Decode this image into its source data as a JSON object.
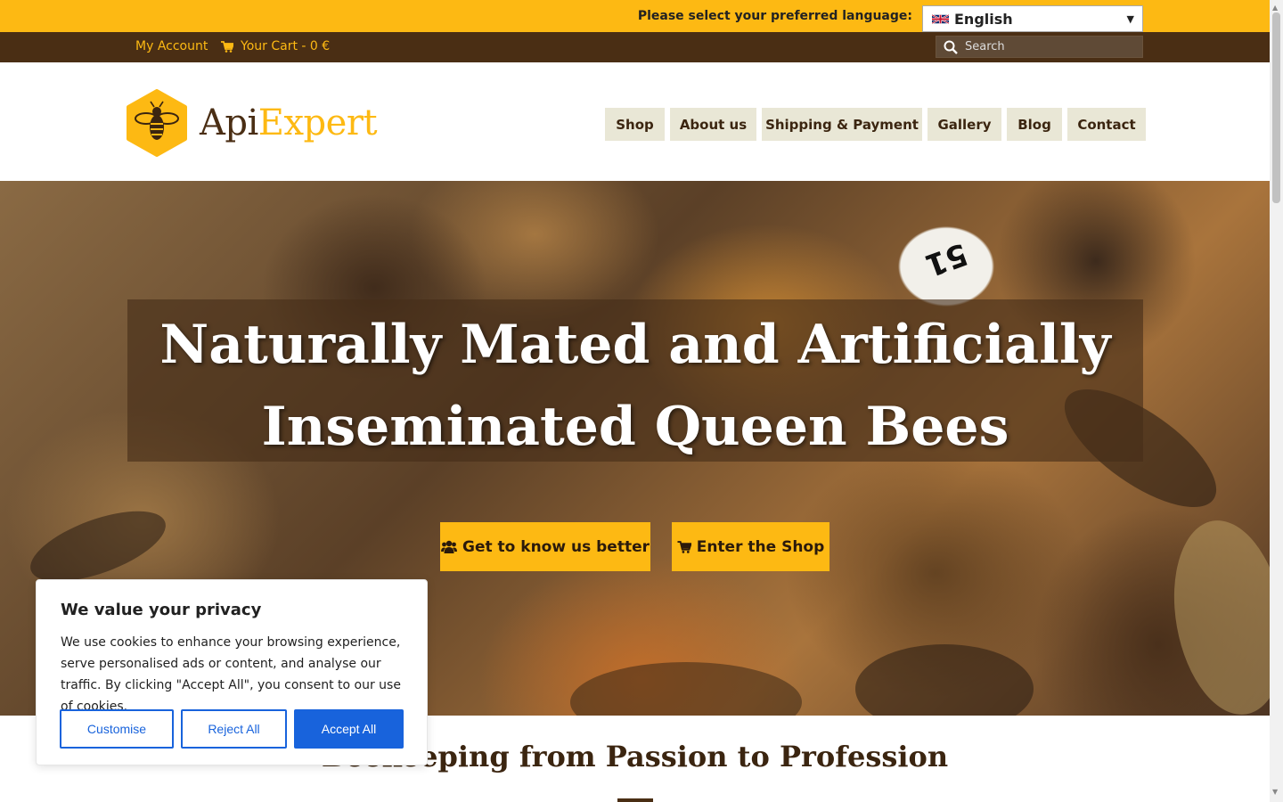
{
  "language_bar": {
    "prompt": "Please select your preferred language:",
    "selected_language": "English"
  },
  "account_bar": {
    "my_account": "My Account",
    "cart": "Your Cart - 0 €",
    "search_placeholder": "Search"
  },
  "logo": {
    "name_part1": "Api",
    "name_part2": "Expert"
  },
  "main_menu": {
    "items": [
      "Shop",
      "About us",
      "Shipping & Payment",
      "Gallery",
      "Blog",
      "Contact"
    ]
  },
  "hero": {
    "title_line1": "Naturally Mated and Artificially",
    "title_line2": "Inseminated Queen Bees",
    "button_about": "Get to know us better",
    "button_shop": "Enter the Shop",
    "queen_marker_number": "51"
  },
  "section": {
    "title": "Beekeeping from Passion to Profession"
  },
  "cookie_banner": {
    "title": "We value your privacy",
    "text": "We use cookies to enhance your browsing experience, serve personalised ads or content, and analyse our traffic. By clicking \"Accept All\", you consent to our use of cookies.",
    "customise": "Customise",
    "reject": "Reject All",
    "accept": "Accept All"
  },
  "colors": {
    "brand_yellow": "#fdb913",
    "brand_brown": "#4a2e14",
    "menu_bg": "#e9e7d6",
    "cookie_blue": "#1863dc"
  },
  "icons": {
    "cart": "shopping-cart-icon",
    "search": "search-icon",
    "users": "users-icon",
    "flag": "uk-flag-icon",
    "bee": "bee-logo-icon"
  }
}
